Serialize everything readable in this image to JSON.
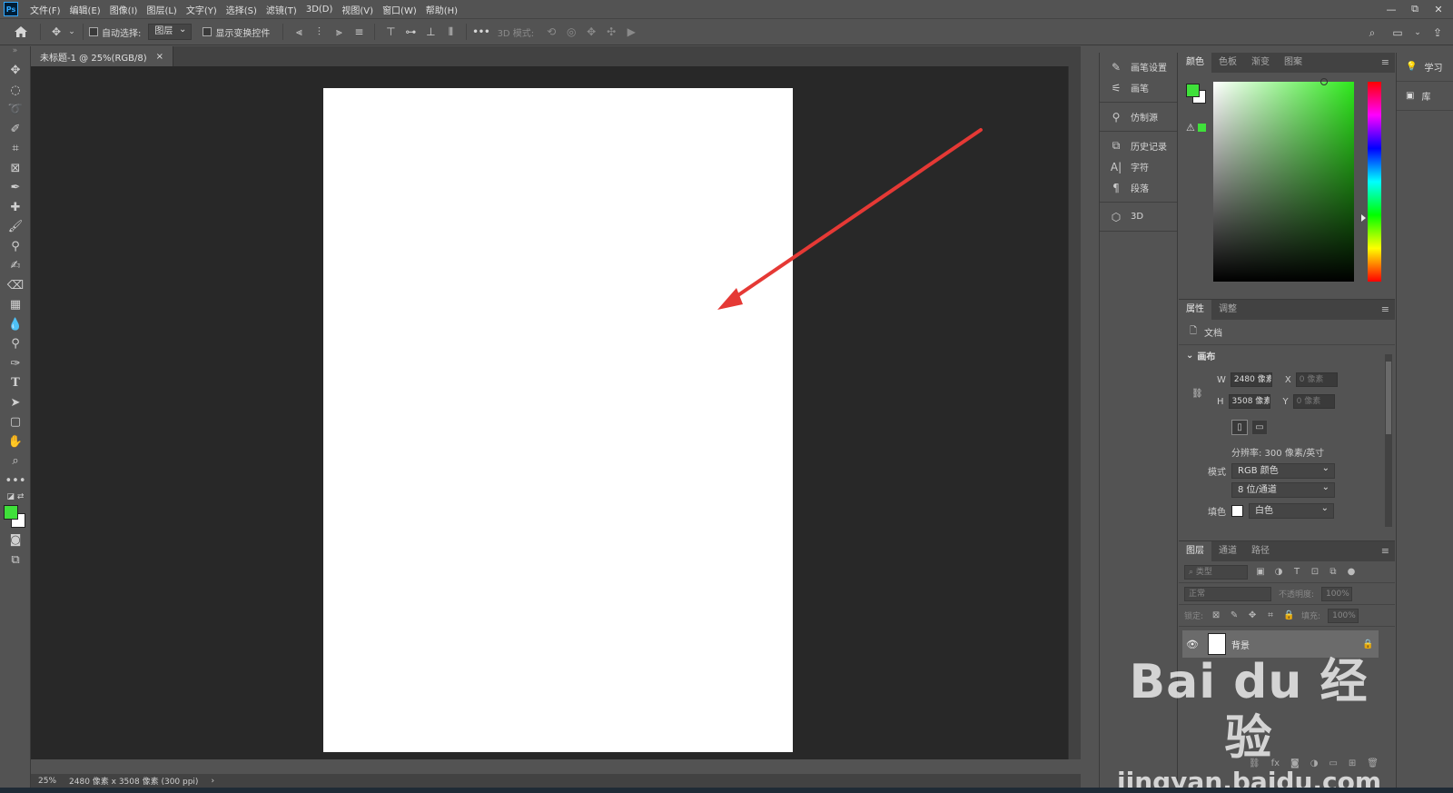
{
  "menubar": {
    "logo": "Ps",
    "items": [
      "文件(F)",
      "编辑(E)",
      "图像(I)",
      "图层(L)",
      "文字(Y)",
      "选择(S)",
      "滤镜(T)",
      "3D(D)",
      "视图(V)",
      "窗口(W)",
      "帮助(H)"
    ],
    "window_controls": [
      "—",
      "⧉",
      "✕"
    ]
  },
  "options": {
    "auto_select_label": "自动选择:",
    "auto_select_target": "图层",
    "show_transform_label": "显示变换控件",
    "more": "•••",
    "mode_3d_label": "3D 模式:"
  },
  "document": {
    "tab_title": "未标题-1 @ 25%(RGB/8)",
    "tab_close": "×",
    "status_zoom": "25%",
    "status_info": "2480 像素 x 3508 像素 (300 ppi)",
    "status_arrow": "›"
  },
  "collapsed_panels": [
    {
      "icon": "brush-settings-icon",
      "glyph": "✎",
      "label": "画笔设置"
    },
    {
      "icon": "brush-icon",
      "glyph": "⚟",
      "label": "画笔"
    },
    {
      "icon": "clone-source-icon",
      "glyph": "⚲",
      "label": "仿制源"
    },
    {
      "icon": "history-icon",
      "glyph": "⧉",
      "label": "历史记录"
    },
    {
      "icon": "character-icon",
      "glyph": "A|",
      "label": "字符"
    },
    {
      "icon": "paragraph-icon",
      "glyph": "¶",
      "label": "段落"
    },
    {
      "icon": "3d-icon",
      "glyph": "⬡",
      "label": "3D"
    }
  ],
  "color_panel": {
    "tabs": [
      "颜色",
      "色板",
      "渐变",
      "图案"
    ],
    "foreground": "#3fe03a",
    "background": "#ffffff"
  },
  "properties": {
    "tabs": [
      "属性",
      "调整"
    ],
    "doc_label": "文档",
    "section": "画布",
    "w_label": "W",
    "w_value": "2480 像素",
    "h_label": "H",
    "h_value": "3508 像素",
    "x_label": "X",
    "x_value": "0 像素",
    "y_label": "Y",
    "y_value": "0 像素",
    "resolution": "分辨率: 300 像素/英寸",
    "mode_label": "模式",
    "mode_value": "RGB 颜色",
    "depth_value": "8 位/通道",
    "fill_label": "填色",
    "fill_value": "白色"
  },
  "layers": {
    "tabs": [
      "图层",
      "通道",
      "路径"
    ],
    "filter_placeholder": "类型",
    "blend_mode": "正常",
    "opacity_label": "不透明度:",
    "opacity_value": "100%",
    "lock_label": "锁定:",
    "fill_label": "填充:",
    "fill_value": "100%",
    "layer_name": "背景",
    "footer_icons": [
      "⛓",
      "fx",
      "◙",
      "◑",
      "▭",
      "⊞",
      "🗑"
    ]
  },
  "learn_panel": [
    {
      "icon": "learn-icon",
      "glyph": "💡",
      "label": "学习"
    },
    {
      "icon": "library-icon",
      "glyph": "▣",
      "label": "库"
    }
  ],
  "watermark": {
    "brand": "Bai du 经验",
    "url": "jingyan.baidu.com"
  },
  "colors": {
    "ui_bg": "#535353",
    "canvas_bg": "#282828",
    "arrow": "#e53935"
  }
}
